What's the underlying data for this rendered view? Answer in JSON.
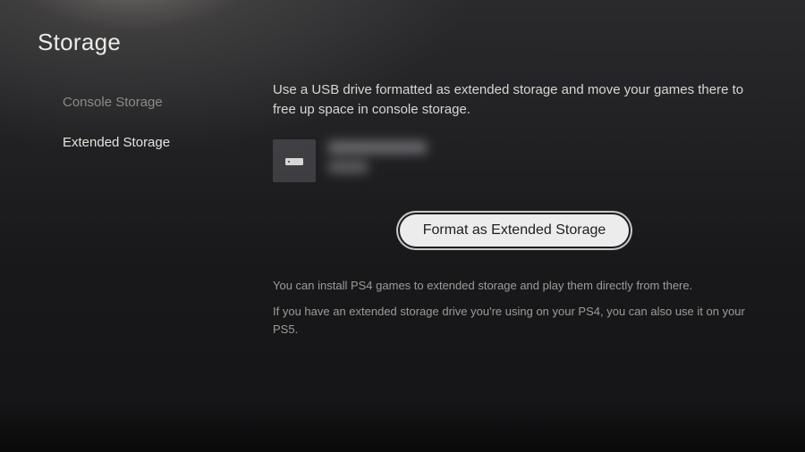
{
  "title": "Storage",
  "sidebar": {
    "items": [
      {
        "label": "Console Storage",
        "active": false
      },
      {
        "label": "Extended Storage",
        "active": true
      }
    ]
  },
  "main": {
    "description": "Use a USB drive formatted as extended storage and move your games there to free up space in console storage.",
    "drive": {
      "icon": "hdd-icon",
      "name": "",
      "detail": ""
    },
    "format_button_label": "Format as Extended Storage",
    "hint1": "You can install PS4 games to extended storage and play them directly from there.",
    "hint2": "If you have an extended storage drive you're using on your PS4, you can also use it on your PS5."
  }
}
